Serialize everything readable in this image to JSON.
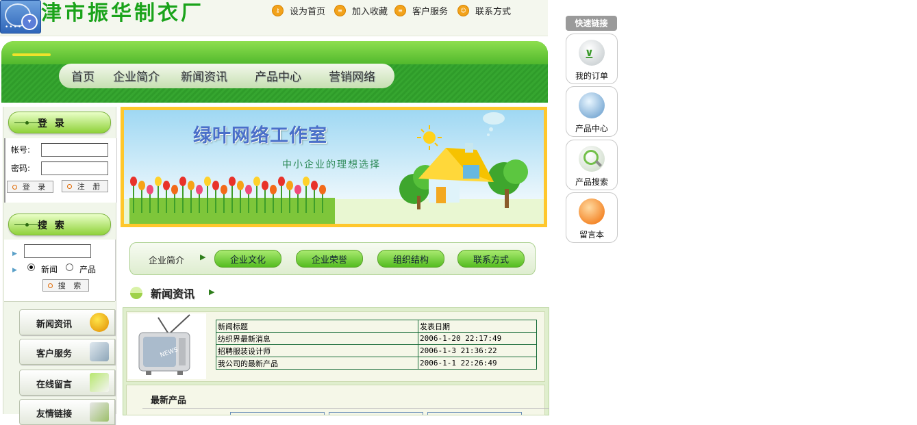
{
  "header": {
    "site_title": "津市振华制衣厂",
    "links": [
      {
        "label": "设为首页",
        "icon": "key-icon"
      },
      {
        "label": "加入收藏",
        "icon": "bookmark-icon"
      },
      {
        "label": "客户服务",
        "icon": "service-icon"
      },
      {
        "label": "联系方式",
        "icon": "contact-icon"
      }
    ]
  },
  "nav": {
    "items": [
      "首页",
      "企业简介",
      "新闻资讯",
      "产品中心",
      "营销网络"
    ]
  },
  "login": {
    "heading": "登 录",
    "account_label": "帐号:",
    "password_label": "密码:",
    "account_value": "",
    "password_value": "",
    "login_button": "登 录",
    "register_button": "注 册"
  },
  "search": {
    "heading": "搜 索",
    "query": "",
    "option_news": "新闻",
    "option_product": "产品",
    "selected": "新闻",
    "button": "搜 索"
  },
  "side_buttons": [
    "新闻资讯",
    "客户服务",
    "在线留言",
    "友情链接"
  ],
  "banner": {
    "title": "绿叶网络工作室",
    "slogan": "中小企业的理想选择"
  },
  "subnav": {
    "label": "企业简介",
    "pills": [
      "企业文化",
      "企业荣誉",
      "组织结构",
      "联系方式"
    ]
  },
  "news": {
    "heading": "新闻资讯",
    "columns": [
      "新闻标题",
      "发表日期"
    ],
    "rows": [
      [
        "纺织界最新消息",
        "2006-1-20 22:17:49"
      ],
      [
        "招聘服装设计师",
        "2006-1-3 21:36:22"
      ],
      [
        "我公司的最新产品",
        "2006-1-1 22:26:49"
      ]
    ]
  },
  "products": {
    "heading": "最新产品"
  },
  "quick_links": {
    "heading": "快速链接",
    "items": [
      {
        "label": "我的订单",
        "icon": "cart-icon"
      },
      {
        "label": "产品中心",
        "icon": "products-icon"
      },
      {
        "label": "产品搜索",
        "icon": "magnifier-icon"
      },
      {
        "label": "留言本",
        "icon": "guestbook-icon"
      }
    ]
  },
  "colors": {
    "brand_green": "#36a630",
    "title_green": "#1aa31a",
    "banner_frame": "#ffc72c",
    "table_border": "#176b38"
  }
}
